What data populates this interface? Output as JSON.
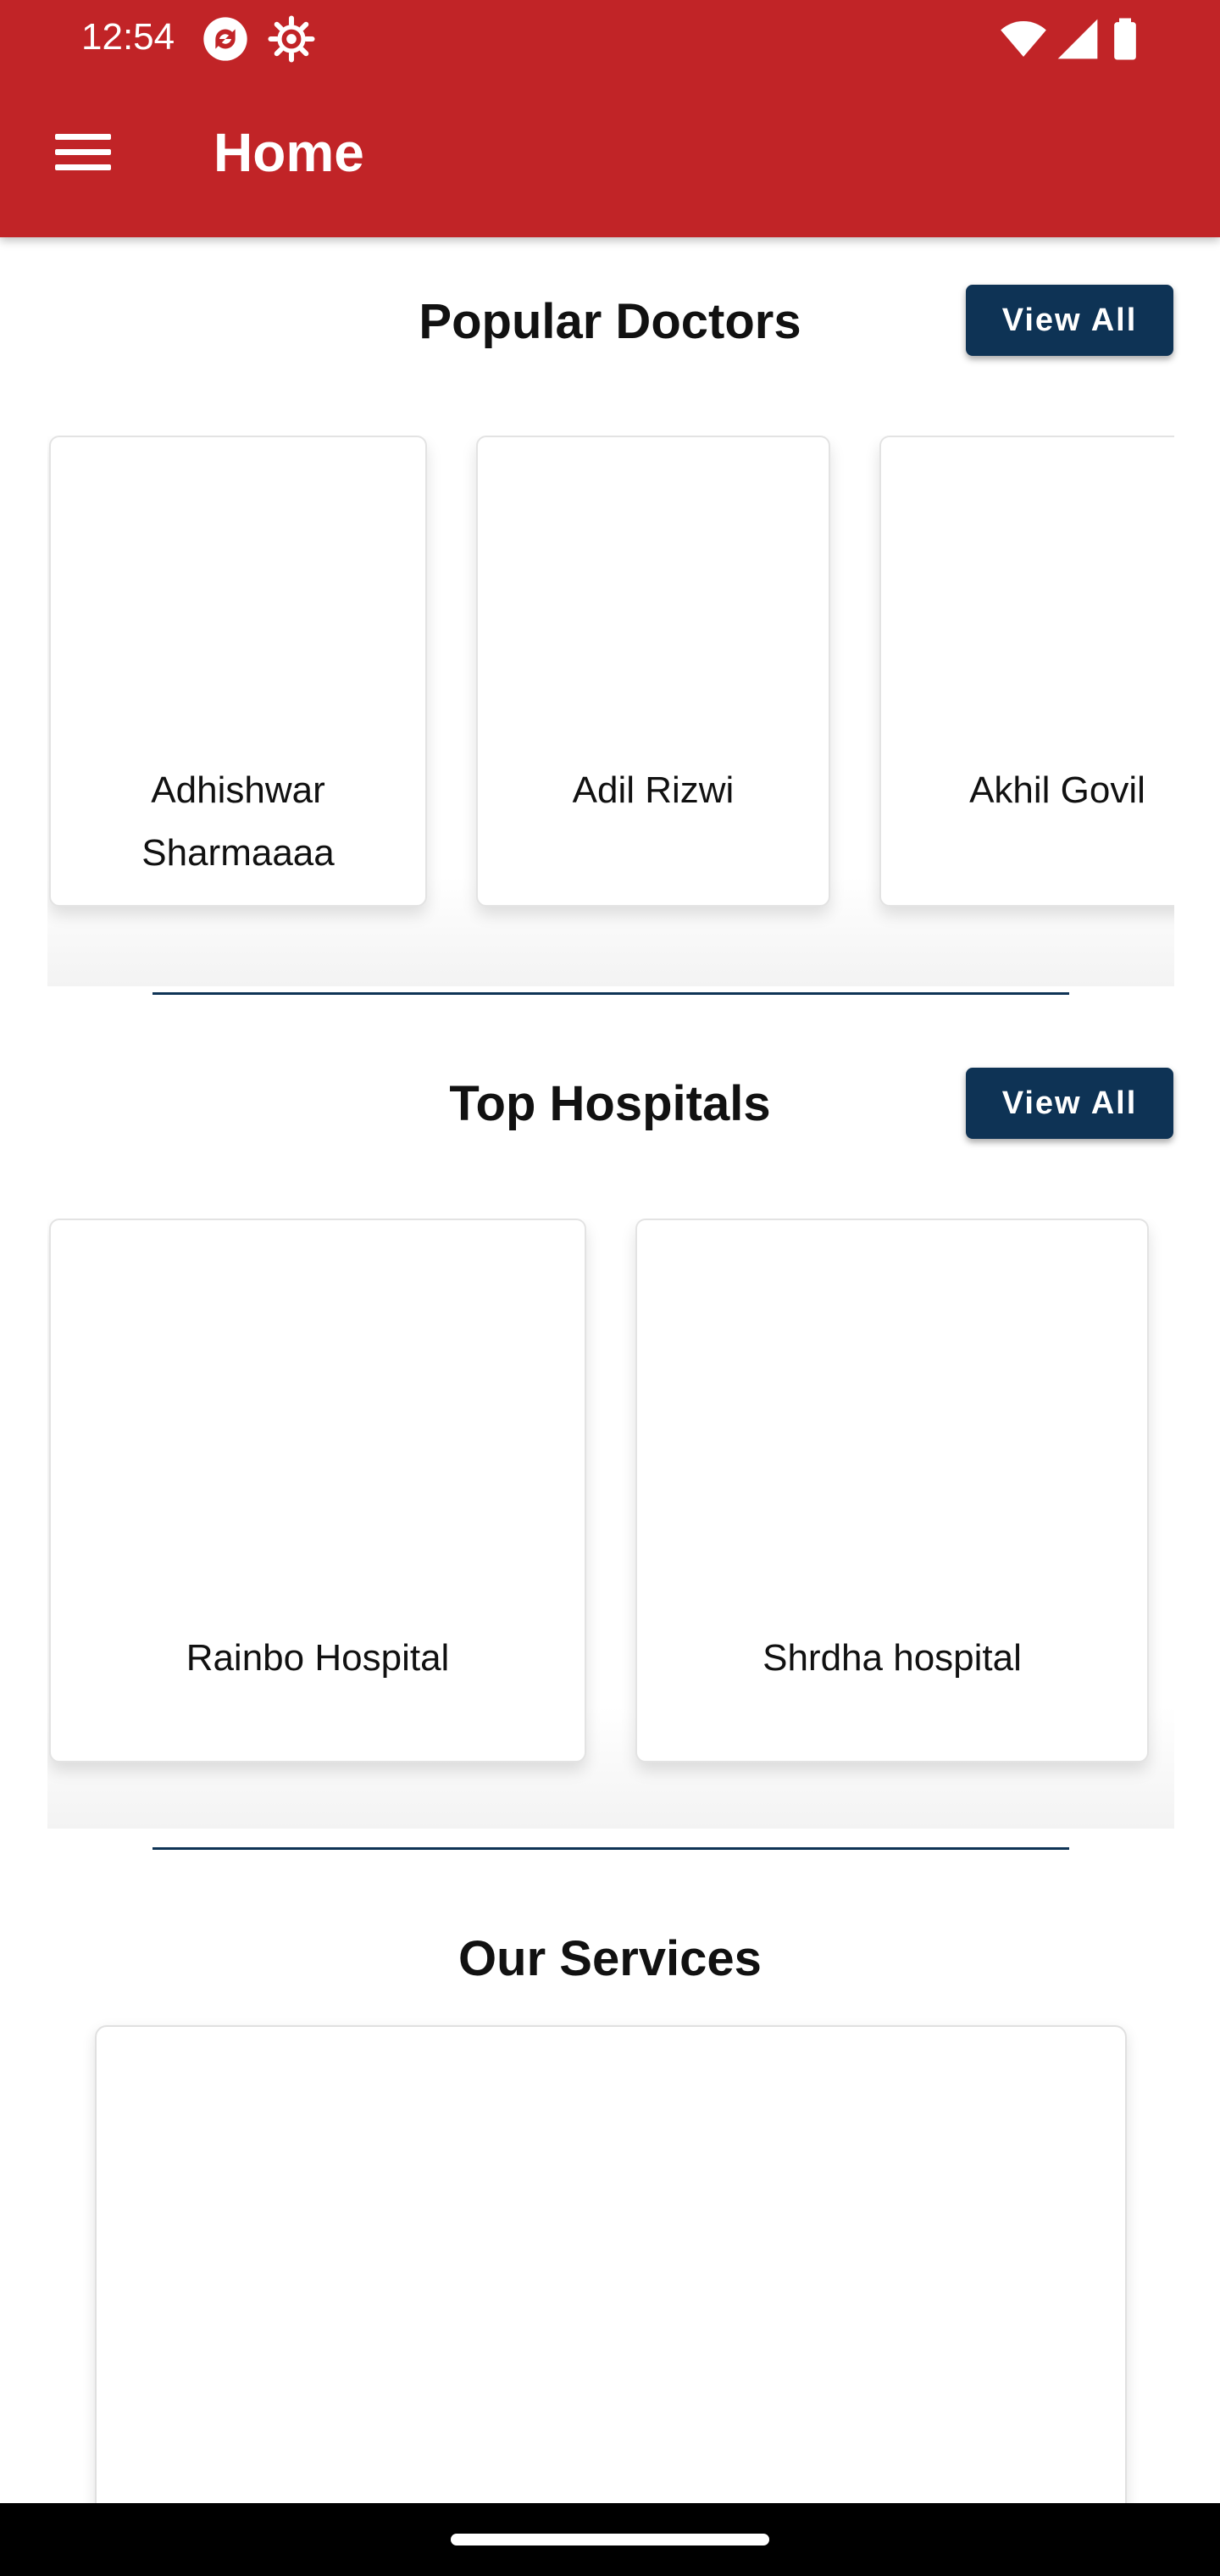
{
  "status_bar": {
    "time": "12:54",
    "icons": [
      "sync-icon",
      "settings-gear-icon",
      "wifi-icon",
      "signal-icon",
      "battery-icon"
    ]
  },
  "app_bar": {
    "title": "Home",
    "menu_icon": "hamburger-menu-icon",
    "background_color": "#c12427"
  },
  "popular_doctors": {
    "title": "Popular Doctors",
    "view_all_label": "View All",
    "doctors": [
      {
        "name": "Adhishwar Sharmaaaa"
      },
      {
        "name": "Adil Rizwi"
      },
      {
        "name": "Akhil Govil"
      }
    ]
  },
  "top_hospitals": {
    "title": "Top Hospitals",
    "view_all_label": "View All",
    "hospitals": [
      {
        "name": "Rainbo Hospital"
      },
      {
        "name": "Shrdha hospital"
      }
    ]
  },
  "our_services": {
    "title": "Our Services"
  },
  "colors": {
    "accent": "#c12427",
    "button": "#0e3355",
    "divider": "#0e3355"
  }
}
